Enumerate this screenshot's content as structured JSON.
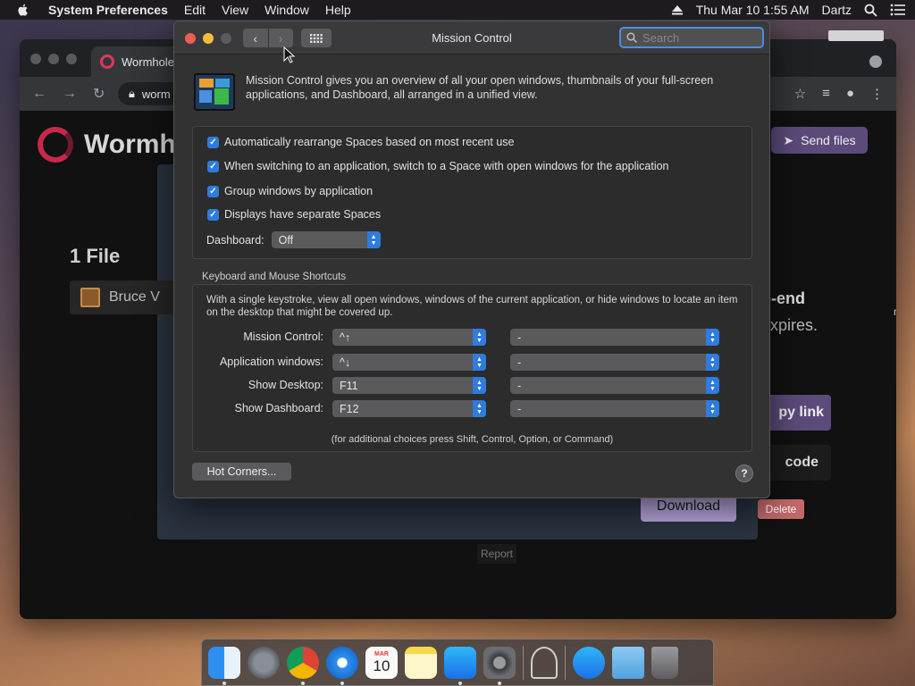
{
  "menubar": {
    "app_name": "System Preferences",
    "items": [
      "Edit",
      "View",
      "Window",
      "Help"
    ],
    "datetime": "Thu Mar 10  1:55 AM",
    "user": "Dartz"
  },
  "browser": {
    "tab_title": "Wormhole",
    "url": "worm",
    "brand": "Wormh",
    "send_files": "Send files",
    "file_count": "1 File",
    "file_name": "Bruce V",
    "e2e_text": "o-end",
    "expires_text": "expires.",
    "side_text": "m",
    "copy_link": "py link",
    "code_label": "code",
    "download": "Download",
    "delete": "Delete",
    "report": "Report"
  },
  "prefs": {
    "title": "Mission Control",
    "search_placeholder": "Search",
    "intro": "Mission Control gives you an overview of all your open windows, thumbnails of your full-screen applications, and Dashboard, all arranged in a unified view.",
    "checkboxes": [
      {
        "label": "Automatically rearrange Spaces based on most recent use",
        "checked": true
      },
      {
        "label": "When switching to an application, switch to a Space with open windows for the application",
        "checked": true
      },
      {
        "label": "Group windows by application",
        "checked": true
      },
      {
        "label": "Displays have separate Spaces",
        "checked": true
      }
    ],
    "dashboard_label": "Dashboard:",
    "dashboard_value": "Off",
    "shortcuts_title": "Keyboard and Mouse Shortcuts",
    "shortcuts_desc": "With a single keystroke, view all open windows, windows of the current application, or hide windows to locate an item on the desktop that might be covered up.",
    "shortcuts": [
      {
        "label": "Mission Control:",
        "key": "^↑",
        "mouse": "-"
      },
      {
        "label": "Application windows:",
        "key": "^↓",
        "mouse": "-"
      },
      {
        "label": "Show Desktop:",
        "key": "F11",
        "mouse": "-"
      },
      {
        "label": "Show Dashboard:",
        "key": "F12",
        "mouse": "-"
      }
    ],
    "footnote": "(for additional choices press Shift, Control, Option, or Command)",
    "hot_corners": "Hot Corners...",
    "help": "?"
  },
  "dock": {
    "calendar_month": "MAR",
    "calendar_day": "10",
    "apps": [
      "finder",
      "launchpad",
      "chrome",
      "safari",
      "calendar",
      "notes",
      "app-store",
      "system-preferences",
      "xcode-instruments",
      "app-store-2",
      "downloads-folder",
      "trash"
    ]
  }
}
